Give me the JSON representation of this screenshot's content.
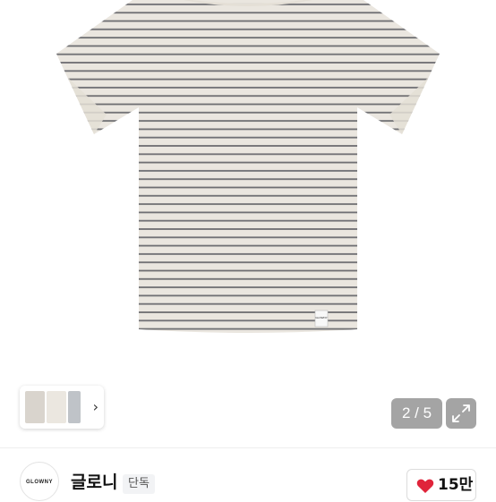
{
  "product": {
    "image_alt": "striped t-shirt",
    "label_text": "GLOWNY"
  },
  "gallery": {
    "counter": "2 / 5",
    "thumbnail_next": "›"
  },
  "brand": {
    "logo_text": "GLOWNY",
    "name": "글로니",
    "badge": "단독"
  },
  "like": {
    "count": "15만",
    "color": "#e0243a"
  },
  "colors": {
    "shirt_base": "#eae6df",
    "stripe": "#6e6e72",
    "overlay": "#5a5a5a"
  }
}
